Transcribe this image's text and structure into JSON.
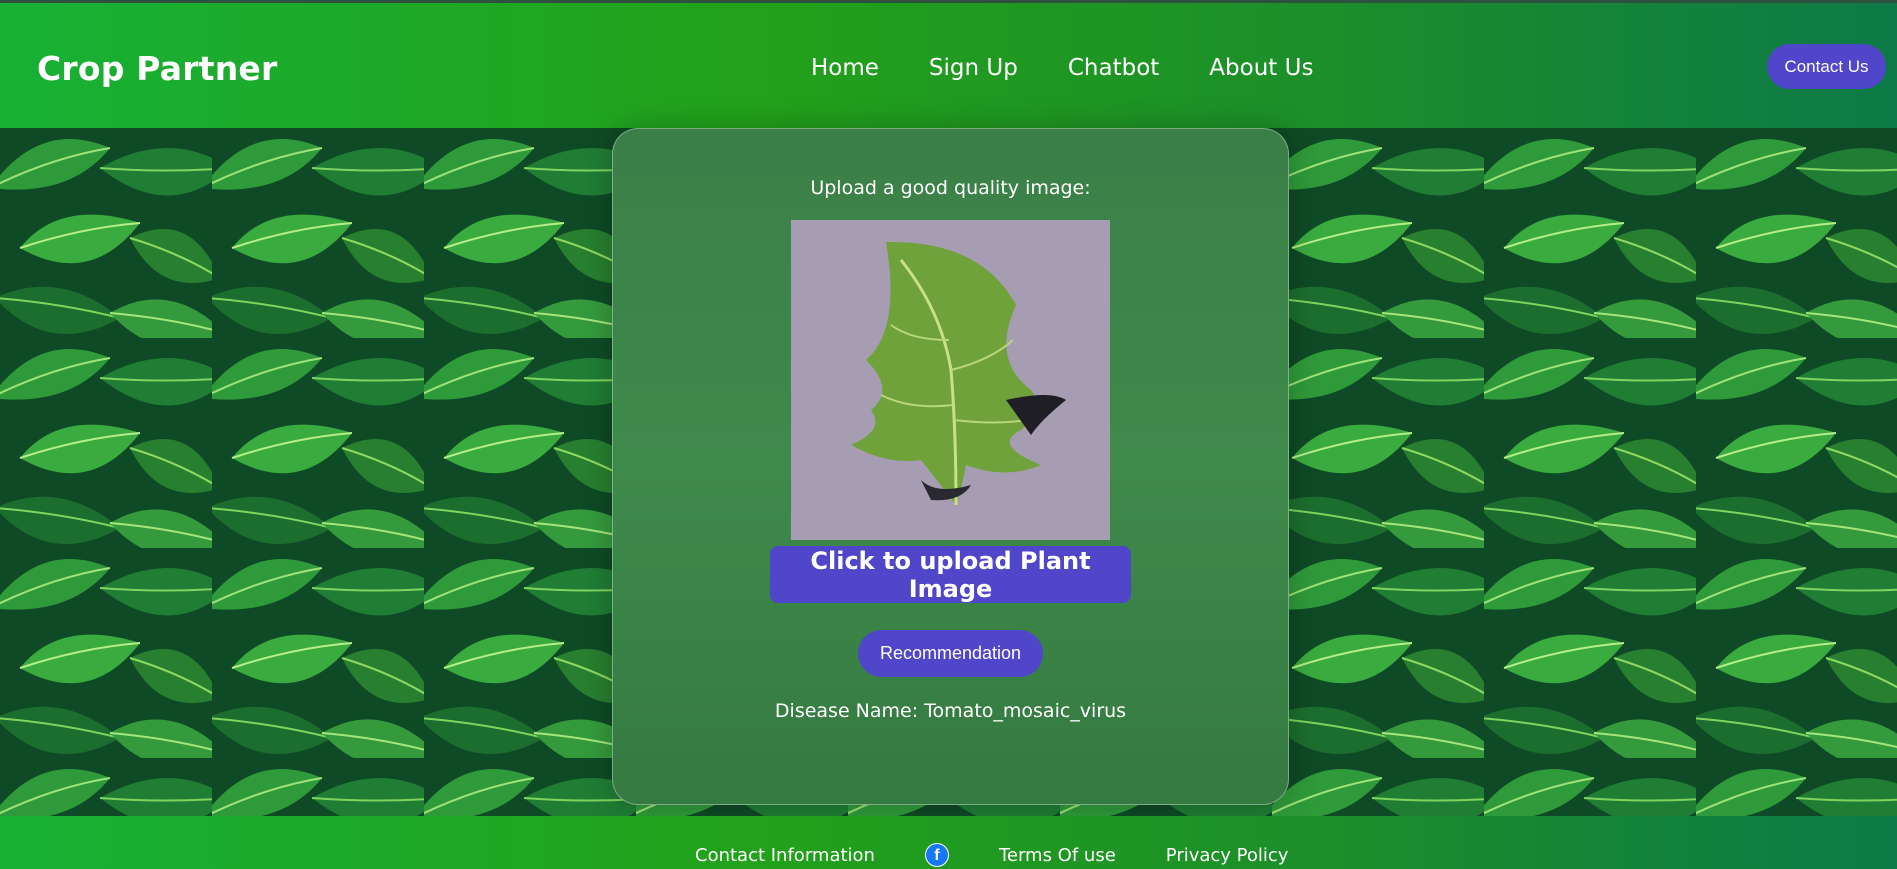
{
  "header": {
    "brand": "Crop Partner",
    "nav": [
      "Home",
      "Sign Up",
      "Chatbot",
      "About Us"
    ],
    "contact_button": "Contact Us"
  },
  "card": {
    "upload_label": "Upload a good quality image:",
    "upload_button": "Click to upload Plant Image",
    "recommendation_button": "Recommendation",
    "result_text": "Disease Name: Tomato_mosaic_virus"
  },
  "footer": {
    "links": [
      "Contact Information",
      "Terms Of use",
      "Privacy Policy"
    ],
    "social_icon": "facebook-icon"
  },
  "colors": {
    "header_gradient_start": "#18b135",
    "header_gradient_end": "#0d7a47",
    "button_accent": "#4f46c9",
    "facebook": "#1877f2"
  }
}
